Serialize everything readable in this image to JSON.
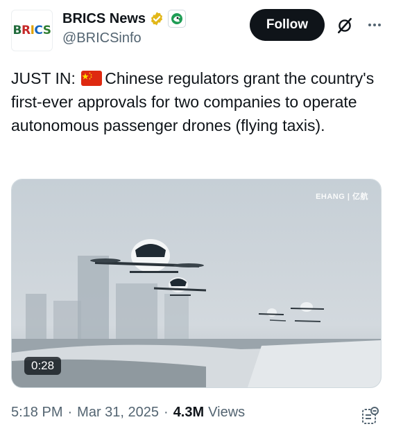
{
  "author": {
    "display_name": "BRICS News",
    "handle": "@BRICSinfo",
    "avatar_text": [
      "B",
      "R",
      "I",
      "C",
      "S"
    ],
    "verified_badge": "gold-check-icon",
    "affiliate_badge": "brics-affiliate-icon"
  },
  "actions": {
    "follow_label": "Follow",
    "grok_icon": "grok-icon",
    "more_icon": "more-options-icon"
  },
  "tweet": {
    "text_prefix": "JUST IN: ",
    "flag": "china-flag-icon",
    "text_body": "Chinese regulators grant the country's first-ever approvals for two companies to operate autonomous passenger drones (flying taxis)."
  },
  "media": {
    "watermark": "EHANG | 亿航",
    "duration": "0:28"
  },
  "meta": {
    "time": "5:18 PM",
    "date": "Mar 31, 2025",
    "views_count": "4.3M",
    "views_label": "Views",
    "note_icon": "community-note-icon"
  },
  "colors": {
    "text_primary": "#0f1419",
    "text_secondary": "#536471",
    "follow_bg": "#0f1419",
    "verified_gold": "#e2b719"
  }
}
